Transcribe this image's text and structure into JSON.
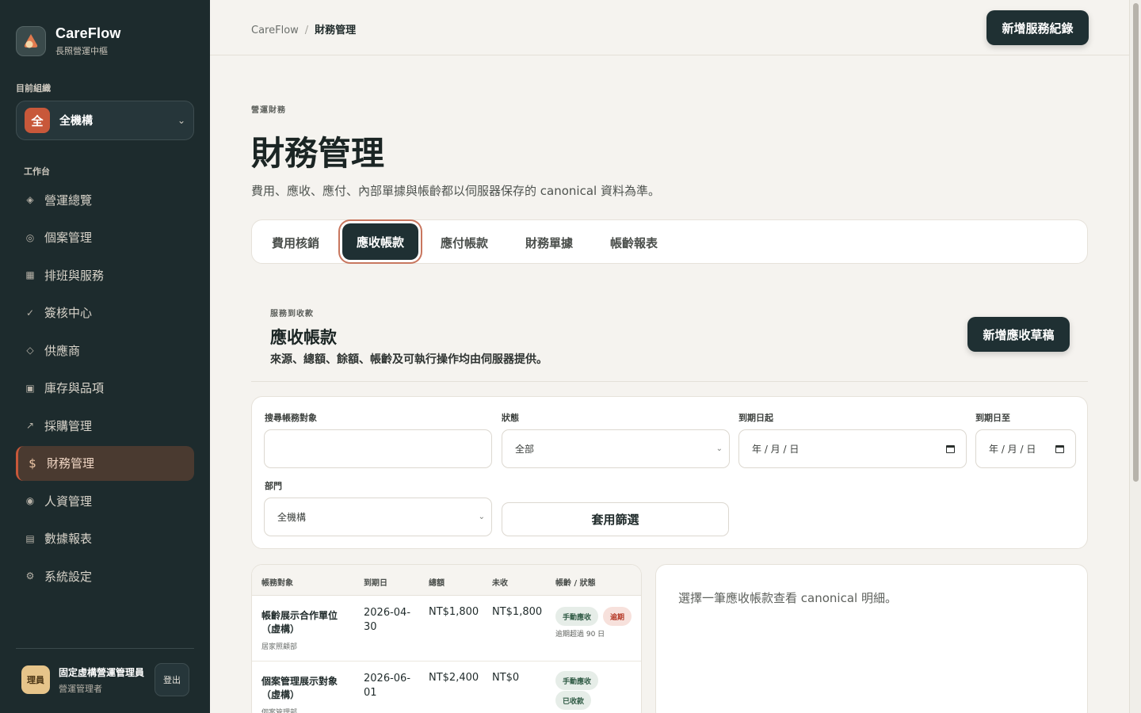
{
  "brand": {
    "name": "CareFlow",
    "subtitle": "長照營運中樞"
  },
  "org": {
    "label": "目前組織",
    "avatar": "全",
    "name": "全機構"
  },
  "workspace_label": "工作台",
  "nav": [
    {
      "icon": "◈",
      "label": "營運總覽"
    },
    {
      "icon": "◎",
      "label": "個案管理"
    },
    {
      "icon": "▦",
      "label": "排班與服務"
    },
    {
      "icon": "✓",
      "label": "簽核中心"
    },
    {
      "icon": "◇",
      "label": "供應商"
    },
    {
      "icon": "▣",
      "label": "庫存與品項"
    },
    {
      "icon": "↗",
      "label": "採購管理"
    },
    {
      "icon": "$",
      "label": "財務管理",
      "active": true
    },
    {
      "icon": "◉",
      "label": "人資管理"
    },
    {
      "icon": "▤",
      "label": "數據報表"
    },
    {
      "icon": "⚙",
      "label": "系統設定"
    }
  ],
  "user": {
    "avatar": "理員",
    "name": "固定虛構營運管理員",
    "role": "營運管理者",
    "logout": "登出"
  },
  "breadcrumb": {
    "root": "CareFlow",
    "sep": "/",
    "current": "財務管理"
  },
  "top_action": "新增服務紀錄",
  "page": {
    "eyebrow": "營運財務",
    "title": "財務管理",
    "desc": "費用、應收、應付、內部單據與帳齡都以伺服器保存的 canonical 資料為準。"
  },
  "tabs": [
    {
      "label": "費用核銷"
    },
    {
      "label": "應收帳款",
      "active": true
    },
    {
      "label": "應付帳款"
    },
    {
      "label": "財務單據"
    },
    {
      "label": "帳齡報表"
    }
  ],
  "section": {
    "eyebrow": "服務到收款",
    "title": "應收帳款",
    "desc": "來源、總額、餘額、帳齡及可執行操作均由伺服器提供。",
    "action": "新增應收草稿"
  },
  "filters": {
    "search_label": "搜尋帳務對象",
    "search_value": "",
    "status_label": "狀態",
    "status_value": "全部",
    "due_from_label": "到期日起",
    "due_from_value": "年 / 月 / 日",
    "due_to_label": "到期日至",
    "due_to_value": "年 / 月 / 日",
    "dept_label": "部門",
    "dept_value": "全機構",
    "apply": "套用篩選"
  },
  "table": {
    "headers": [
      "帳務對象",
      "到期日",
      "總額",
      "未收",
      "帳齡 / 狀態"
    ],
    "rows": [
      {
        "name": "帳齡展示合作單位（虛構）",
        "dept": "居家照顧部",
        "due": "2026-04-30",
        "total": "NT$1,800",
        "outstanding": "NT$1,800",
        "badges": [
          "手動應收",
          "逾期"
        ],
        "aging": "逾期超過 90 日"
      },
      {
        "name": "個案管理展示對象（虛構）",
        "dept": "個案管理部",
        "due": "2026-06-01",
        "total": "NT$2,400",
        "outstanding": "NT$0",
        "badges": [
          "手動應收",
          "已收款"
        ]
      }
    ]
  },
  "detail": {
    "placeholder": "選擇一筆應收帳款查看 canonical 明細。"
  },
  "colors": {
    "sidebar": "#1d2b2d",
    "primary": "#1f3033",
    "accent": "#c8583a"
  }
}
